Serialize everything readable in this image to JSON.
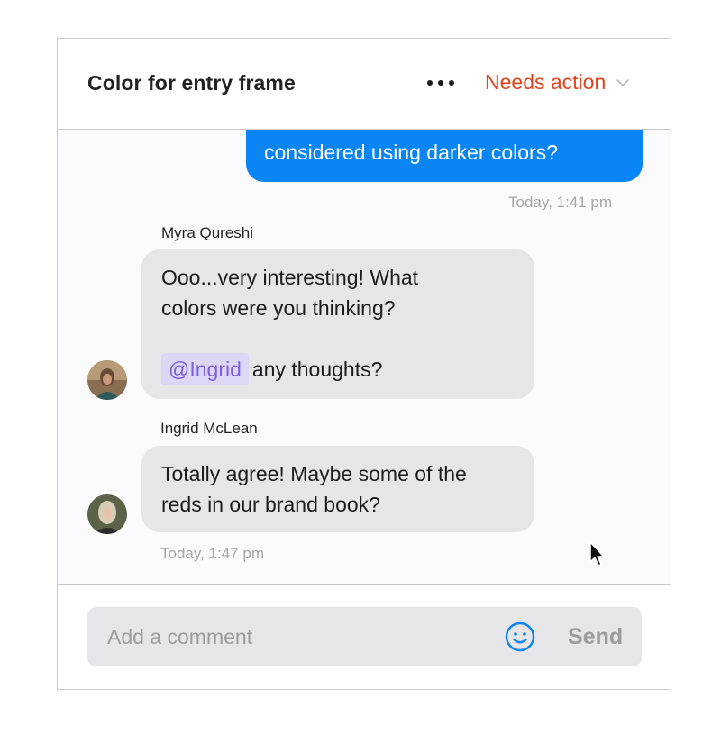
{
  "header": {
    "title": "Color for entry frame",
    "more_icon": "more-horizontal-icon",
    "status_label": "Needs action",
    "status_color": "#e2431d"
  },
  "messages": {
    "outgoing": {
      "partial_text": "considered using darker colors?",
      "timestamp": "Today, 1:41 pm",
      "color": "#0a85f5"
    },
    "myra": {
      "author": "Myra Qureshi",
      "line1": "Ooo...very interesting! What",
      "line2": "colors were you thinking?",
      "mention": "@Ingrid",
      "line3": "any thoughts?"
    },
    "ingrid": {
      "author": "Ingrid McLean",
      "line1": "Totally agree! Maybe some of the",
      "line2": "reds in our brand book?",
      "timestamp": "Today, 1:47 pm"
    }
  },
  "composer": {
    "placeholder": "Add a comment",
    "emoji_icon": "smiley-icon",
    "send_label": "Send"
  }
}
